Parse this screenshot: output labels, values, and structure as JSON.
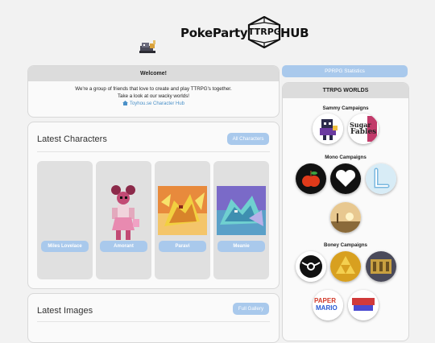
{
  "header": {
    "logo_left": "PokeParty",
    "logo_die": "TTRPG",
    "logo_right": "HUB"
  },
  "welcome": {
    "title": "Welcome!",
    "line1": "We're a group of friends that love to create and play TTRPG's together.",
    "line2": "Take a look at our wacky worlds!",
    "link": "Toyhou.se Character Hub"
  },
  "characters": {
    "title": "Latest Characters",
    "button": "All Characters",
    "items": [
      {
        "name": "Miles Lovelace"
      },
      {
        "name": "Amorant"
      },
      {
        "name": "Paravi"
      },
      {
        "name": "Meanie"
      }
    ]
  },
  "images": {
    "title": "Latest Images",
    "button": "Full Gallery"
  },
  "sidebar": {
    "stats_button": "PPRPG Statistics",
    "worlds_title": "TTRPG WORLDS",
    "groups": [
      {
        "title": "Sammy Campaigns",
        "worlds": [
          "pixel-character",
          "sugar-fables"
        ],
        "fables_text_1": "Sugar",
        "fables_text_2": "Fables"
      },
      {
        "title": "Mono Campaigns",
        "worlds": [
          "apple",
          "heart",
          "l-letter",
          "sunset"
        ]
      },
      {
        "title": "Boney Campaigns",
        "worlds": [
          "ball",
          "triforce",
          "ruins",
          "paper-mario",
          "pokemon"
        ],
        "paper_text_1": "PAPER",
        "paper_text_2": "MARIO"
      }
    ]
  }
}
